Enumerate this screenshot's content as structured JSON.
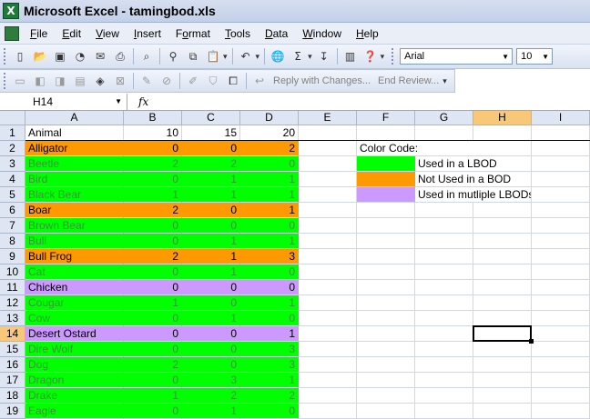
{
  "window": {
    "title": "Microsoft Excel - tamingbod.xls",
    "app_icon_letter": "X"
  },
  "menu": [
    "File",
    "Edit",
    "View",
    "Insert",
    "Format",
    "Tools",
    "Data",
    "Window",
    "Help"
  ],
  "menu_underline": [
    "F",
    "E",
    "V",
    "I",
    "o",
    "T",
    "D",
    "W",
    "H"
  ],
  "toolbar": {
    "font_name": "Arial",
    "font_size": "10"
  },
  "reviewing": {
    "reply": "Reply with Changes...",
    "end": "End Review..."
  },
  "formula_bar": {
    "name_box": "H14",
    "fx": "fx"
  },
  "columns": [
    "A",
    "B",
    "C",
    "D",
    "E",
    "F",
    "G",
    "H",
    "I"
  ],
  "selected_column": "H",
  "selected_row": 14,
  "rows": [
    {
      "n": 1,
      "a": "Animal",
      "b": "10",
      "c": "15",
      "d": "20",
      "fill": "white",
      "text": "black"
    },
    {
      "n": 2,
      "a": "Alligator",
      "b": "0",
      "c": "0",
      "d": "2",
      "fill": "orange",
      "text": "black"
    },
    {
      "n": 3,
      "a": "Beetle",
      "b": "2",
      "c": "2",
      "d": "0",
      "fill": "green",
      "text": "green"
    },
    {
      "n": 4,
      "a": "Bird",
      "b": "0",
      "c": "1",
      "d": "1",
      "fill": "green",
      "text": "green"
    },
    {
      "n": 5,
      "a": "Black Bear",
      "b": "1",
      "c": "1",
      "d": "1",
      "fill": "green",
      "text": "green"
    },
    {
      "n": 6,
      "a": "Boar",
      "b": "2",
      "c": "0",
      "d": "1",
      "fill": "orange",
      "text": "black"
    },
    {
      "n": 7,
      "a": "Brown Bear",
      "b": "0",
      "c": "0",
      "d": "0",
      "fill": "green",
      "text": "green"
    },
    {
      "n": 8,
      "a": "Bull",
      "b": "0",
      "c": "1",
      "d": "1",
      "fill": "green",
      "text": "green"
    },
    {
      "n": 9,
      "a": "Bull Frog",
      "b": "2",
      "c": "1",
      "d": "3",
      "fill": "orange",
      "text": "black"
    },
    {
      "n": 10,
      "a": "Cat",
      "b": "0",
      "c": "1",
      "d": "0",
      "fill": "green",
      "text": "green"
    },
    {
      "n": 11,
      "a": "Chicken",
      "b": "0",
      "c": "0",
      "d": "0",
      "fill": "purple",
      "text": "black"
    },
    {
      "n": 12,
      "a": "Cougar",
      "b": "1",
      "c": "0",
      "d": "1",
      "fill": "green",
      "text": "green"
    },
    {
      "n": 13,
      "a": "Cow",
      "b": "0",
      "c": "1",
      "d": "0",
      "fill": "green",
      "text": "green"
    },
    {
      "n": 14,
      "a": "Desert Ostard",
      "b": "0",
      "c": "0",
      "d": "1",
      "fill": "purple",
      "text": "black"
    },
    {
      "n": 15,
      "a": "Dire Wolf",
      "b": "0",
      "c": "0",
      "d": "3",
      "fill": "green",
      "text": "green"
    },
    {
      "n": 16,
      "a": "Dog",
      "b": "2",
      "c": "0",
      "d": "3",
      "fill": "green",
      "text": "green"
    },
    {
      "n": 17,
      "a": "Dragon",
      "b": "0",
      "c": "3",
      "d": "1",
      "fill": "green",
      "text": "green"
    },
    {
      "n": 18,
      "a": "Drake",
      "b": "1",
      "c": "2",
      "d": "2",
      "fill": "green",
      "text": "green"
    },
    {
      "n": 19,
      "a": "Eagle",
      "b": "0",
      "c": "1",
      "d": "0",
      "fill": "green",
      "text": "green"
    }
  ],
  "legend": {
    "title": "Color Code:",
    "items": [
      {
        "fill": "green",
        "label": "Used in a LBOD"
      },
      {
        "fill": "orange",
        "label": "Not Used in a BOD"
      },
      {
        "fill": "purple",
        "label": "Used in mutliple LBODs"
      }
    ]
  },
  "colors": {
    "green": "#00ff00",
    "orange": "#ff9900",
    "purple": "#cc99ff",
    "white": "#ffffff",
    "green_text": "#339933",
    "black_text": "#000000"
  }
}
